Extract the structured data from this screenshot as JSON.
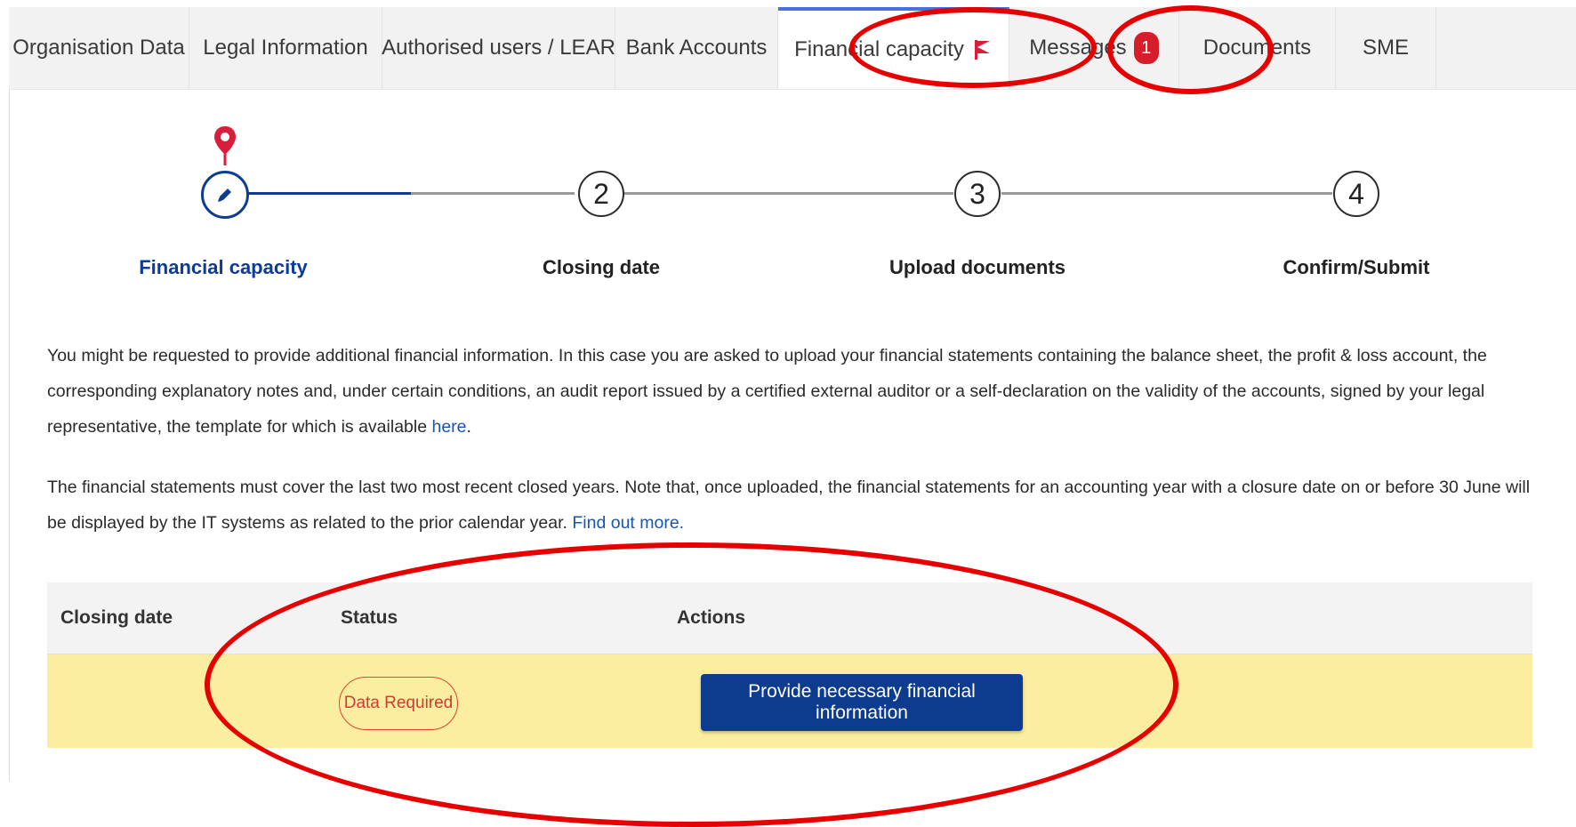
{
  "tabs": [
    {
      "label": "Organisation Data"
    },
    {
      "label": "Legal Information"
    },
    {
      "label": "Authorised users / LEAR"
    },
    {
      "label": "Bank Accounts"
    },
    {
      "label": "Financial capacity",
      "active": true,
      "flag_icon": "flag-icon"
    },
    {
      "label": "Messages",
      "badge": "1"
    },
    {
      "label": "Documents"
    },
    {
      "label": "SME"
    }
  ],
  "stepper": {
    "steps": [
      {
        "number": "",
        "icon": "pencil-icon",
        "label": "Financial capacity",
        "current": true
      },
      {
        "number": "2",
        "label": "Closing date"
      },
      {
        "number": "3",
        "label": "Upload documents"
      },
      {
        "number": "4",
        "label": "Confirm/Submit"
      }
    ]
  },
  "intro": {
    "text": "You might be requested to provide additional financial information. In this case you are asked to upload your financial statements containing the balance sheet, the profit & loss account, the corresponding explanatory notes and, under certain conditions, an audit report issued by a certified external auditor or a self-declaration on the validity of the accounts, signed by your legal representative, the template for which is available ",
    "link": "here",
    "end": "."
  },
  "note": {
    "text": "The financial statements must cover the last two most recent closed years. Note that, once uploaded, the financial statements for an accounting year with a closure date on or before 30 June will be displayed by the IT systems as related to the prior calendar year. ",
    "link": "Find out more."
  },
  "table": {
    "headers": {
      "closing_date": "Closing date",
      "status": "Status",
      "actions": "Actions"
    },
    "rows": [
      {
        "closing_date": "",
        "status": "Data Required",
        "action": "Provide necessary financial information"
      }
    ]
  },
  "colors": {
    "accent": "#0d3c8f",
    "row_highlight": "#fbeea0",
    "status_red": "#d23b34",
    "annotation_red": "#e60000"
  }
}
